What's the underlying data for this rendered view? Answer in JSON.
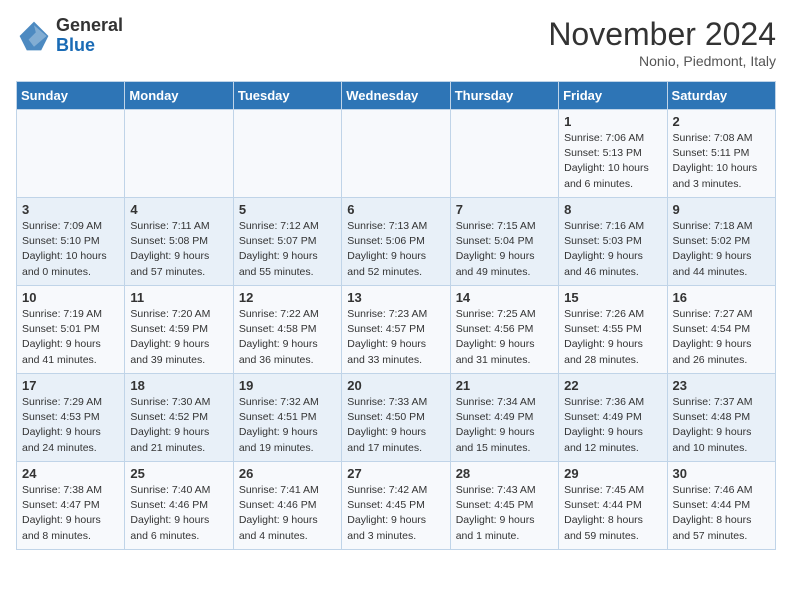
{
  "logo": {
    "general": "General",
    "blue": "Blue"
  },
  "header": {
    "month": "November 2024",
    "location": "Nonio, Piedmont, Italy"
  },
  "weekdays": [
    "Sunday",
    "Monday",
    "Tuesday",
    "Wednesday",
    "Thursday",
    "Friday",
    "Saturday"
  ],
  "weeks": [
    [
      {
        "day": "",
        "info": ""
      },
      {
        "day": "",
        "info": ""
      },
      {
        "day": "",
        "info": ""
      },
      {
        "day": "",
        "info": ""
      },
      {
        "day": "",
        "info": ""
      },
      {
        "day": "1",
        "info": "Sunrise: 7:06 AM\nSunset: 5:13 PM\nDaylight: 10 hours\nand 6 minutes."
      },
      {
        "day": "2",
        "info": "Sunrise: 7:08 AM\nSunset: 5:11 PM\nDaylight: 10 hours\nand 3 minutes."
      }
    ],
    [
      {
        "day": "3",
        "info": "Sunrise: 7:09 AM\nSunset: 5:10 PM\nDaylight: 10 hours\nand 0 minutes."
      },
      {
        "day": "4",
        "info": "Sunrise: 7:11 AM\nSunset: 5:08 PM\nDaylight: 9 hours\nand 57 minutes."
      },
      {
        "day": "5",
        "info": "Sunrise: 7:12 AM\nSunset: 5:07 PM\nDaylight: 9 hours\nand 55 minutes."
      },
      {
        "day": "6",
        "info": "Sunrise: 7:13 AM\nSunset: 5:06 PM\nDaylight: 9 hours\nand 52 minutes."
      },
      {
        "day": "7",
        "info": "Sunrise: 7:15 AM\nSunset: 5:04 PM\nDaylight: 9 hours\nand 49 minutes."
      },
      {
        "day": "8",
        "info": "Sunrise: 7:16 AM\nSunset: 5:03 PM\nDaylight: 9 hours\nand 46 minutes."
      },
      {
        "day": "9",
        "info": "Sunrise: 7:18 AM\nSunset: 5:02 PM\nDaylight: 9 hours\nand 44 minutes."
      }
    ],
    [
      {
        "day": "10",
        "info": "Sunrise: 7:19 AM\nSunset: 5:01 PM\nDaylight: 9 hours\nand 41 minutes."
      },
      {
        "day": "11",
        "info": "Sunrise: 7:20 AM\nSunset: 4:59 PM\nDaylight: 9 hours\nand 39 minutes."
      },
      {
        "day": "12",
        "info": "Sunrise: 7:22 AM\nSunset: 4:58 PM\nDaylight: 9 hours\nand 36 minutes."
      },
      {
        "day": "13",
        "info": "Sunrise: 7:23 AM\nSunset: 4:57 PM\nDaylight: 9 hours\nand 33 minutes."
      },
      {
        "day": "14",
        "info": "Sunrise: 7:25 AM\nSunset: 4:56 PM\nDaylight: 9 hours\nand 31 minutes."
      },
      {
        "day": "15",
        "info": "Sunrise: 7:26 AM\nSunset: 4:55 PM\nDaylight: 9 hours\nand 28 minutes."
      },
      {
        "day": "16",
        "info": "Sunrise: 7:27 AM\nSunset: 4:54 PM\nDaylight: 9 hours\nand 26 minutes."
      }
    ],
    [
      {
        "day": "17",
        "info": "Sunrise: 7:29 AM\nSunset: 4:53 PM\nDaylight: 9 hours\nand 24 minutes."
      },
      {
        "day": "18",
        "info": "Sunrise: 7:30 AM\nSunset: 4:52 PM\nDaylight: 9 hours\nand 21 minutes."
      },
      {
        "day": "19",
        "info": "Sunrise: 7:32 AM\nSunset: 4:51 PM\nDaylight: 9 hours\nand 19 minutes."
      },
      {
        "day": "20",
        "info": "Sunrise: 7:33 AM\nSunset: 4:50 PM\nDaylight: 9 hours\nand 17 minutes."
      },
      {
        "day": "21",
        "info": "Sunrise: 7:34 AM\nSunset: 4:49 PM\nDaylight: 9 hours\nand 15 minutes."
      },
      {
        "day": "22",
        "info": "Sunrise: 7:36 AM\nSunset: 4:49 PM\nDaylight: 9 hours\nand 12 minutes."
      },
      {
        "day": "23",
        "info": "Sunrise: 7:37 AM\nSunset: 4:48 PM\nDaylight: 9 hours\nand 10 minutes."
      }
    ],
    [
      {
        "day": "24",
        "info": "Sunrise: 7:38 AM\nSunset: 4:47 PM\nDaylight: 9 hours\nand 8 minutes."
      },
      {
        "day": "25",
        "info": "Sunrise: 7:40 AM\nSunset: 4:46 PM\nDaylight: 9 hours\nand 6 minutes."
      },
      {
        "day": "26",
        "info": "Sunrise: 7:41 AM\nSunset: 4:46 PM\nDaylight: 9 hours\nand 4 minutes."
      },
      {
        "day": "27",
        "info": "Sunrise: 7:42 AM\nSunset: 4:45 PM\nDaylight: 9 hours\nand 3 minutes."
      },
      {
        "day": "28",
        "info": "Sunrise: 7:43 AM\nSunset: 4:45 PM\nDaylight: 9 hours\nand 1 minute."
      },
      {
        "day": "29",
        "info": "Sunrise: 7:45 AM\nSunset: 4:44 PM\nDaylight: 8 hours\nand 59 minutes."
      },
      {
        "day": "30",
        "info": "Sunrise: 7:46 AM\nSunset: 4:44 PM\nDaylight: 8 hours\nand 57 minutes."
      }
    ]
  ]
}
